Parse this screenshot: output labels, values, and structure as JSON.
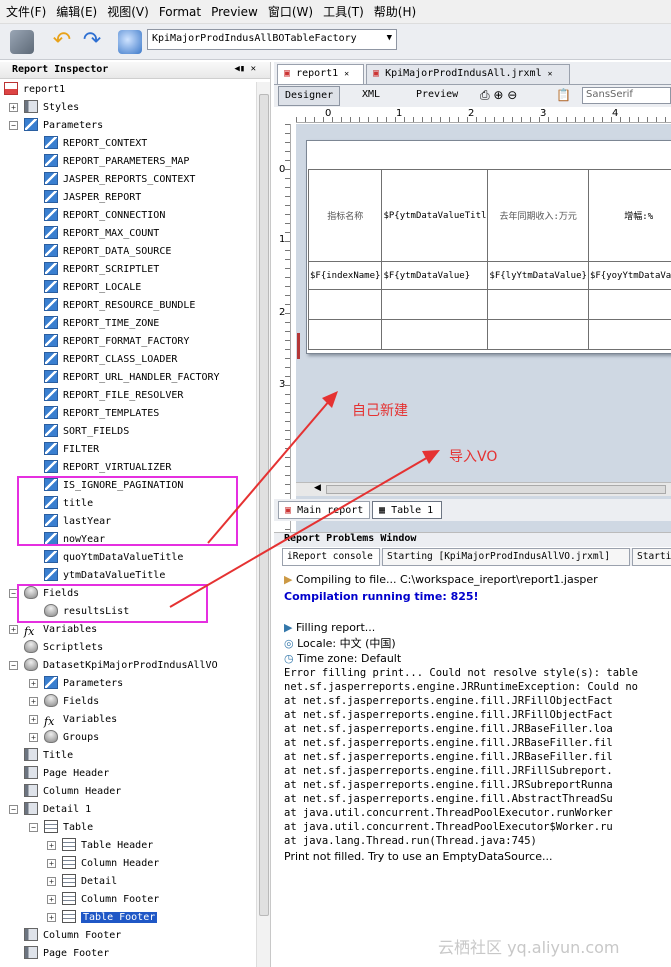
{
  "menu": [
    "文件(F)",
    "编辑(E)",
    "视图(V)",
    "Format",
    "Preview",
    "窗口(W)",
    "工具(T)",
    "帮助(H)"
  ],
  "toolbar": {
    "combo_value": "KpiMajorProdIndusAllBOTableFactory"
  },
  "inspector": {
    "title": "Report Inspector",
    "root": "report1",
    "items": {
      "styles": "Styles",
      "parameters": "Parameters",
      "params": [
        "REPORT_CONTEXT",
        "REPORT_PARAMETERS_MAP",
        "JASPER_REPORTS_CONTEXT",
        "JASPER_REPORT",
        "REPORT_CONNECTION",
        "REPORT_MAX_COUNT",
        "REPORT_DATA_SOURCE",
        "REPORT_SCRIPTLET",
        "REPORT_LOCALE",
        "REPORT_RESOURCE_BUNDLE",
        "REPORT_TIME_ZONE",
        "REPORT_FORMAT_FACTORY",
        "REPORT_CLASS_LOADER",
        "REPORT_URL_HANDLER_FACTORY",
        "REPORT_FILE_RESOLVER",
        "REPORT_TEMPLATES",
        "SORT_FIELDS",
        "FILTER",
        "REPORT_VIRTUALIZER",
        "IS_IGNORE_PAGINATION",
        "title",
        "lastYear",
        "nowYear",
        "quoYtmDataValueTitle",
        "ytmDataValueTitle"
      ],
      "fields": "Fields",
      "field_results": "resultsList",
      "variables": "Variables",
      "scriptlets": "Scriptlets",
      "dataset": "DatasetKpiMajorProdIndusAllVO",
      "ds_parameters": "Parameters",
      "ds_fields": "Fields",
      "ds_variables": "Variables",
      "ds_groups": "Groups",
      "title_band": "Title",
      "page_header": "Page Header",
      "column_header": "Column Header",
      "detail1": "Detail 1",
      "table": "Table",
      "table_header": "Table Header",
      "t_column_header": "Column Header",
      "t_detail": "Detail",
      "t_column_footer": "Column Footer",
      "table_footer": "Table Footer",
      "column_footer": "Column Footer",
      "page_footer": "Page Footer"
    }
  },
  "editor": {
    "tabs": [
      "report1",
      "KpiMajorProdIndusAll.jrxml"
    ],
    "modes": [
      "Designer",
      "XML",
      "Preview"
    ],
    "font_combo": "SansSerif",
    "ruler_h": [
      "0",
      "1",
      "2",
      "3",
      "4"
    ],
    "ruler_v": [
      "0",
      "1",
      "2",
      "3"
    ],
    "table_headers": [
      "指标名称",
      "$P{ytmDataValueTitl",
      "去年同期收入:万元",
      "增幅:%"
    ],
    "table_cells": [
      "$F{indexName}",
      "$F{ytmDataValue}",
      "$F{lyYtmDataValue}",
      "$F{yoyYtmDataValue"
    ],
    "bottom_tabs": [
      "Main report",
      "Table 1"
    ]
  },
  "problems": {
    "title": "Report Problems Window",
    "tabs": [
      "iReport console",
      "Starting [KpiMajorProdIndusAllVO.jrxml]",
      "Startin"
    ],
    "log": [
      {
        "t": "Compiling to file... C:\\workspace_ireport\\report1.jasper",
        "style": "sans"
      },
      {
        "t": "Compilation running time: 825!",
        "style": "blue"
      },
      {
        "t": "Filling report...",
        "style": "sans"
      },
      {
        "t": "Locale: 中文 (中国)",
        "style": "sans"
      },
      {
        "t": "Time zone: Default",
        "style": "sans"
      },
      {
        "t": "Error filling print... Could not resolve style(s): table",
        "style": "mono"
      },
      {
        "t": "net.sf.jasperreports.engine.JRRuntimeException: Could no",
        "style": "mono"
      },
      {
        "t": "    at net.sf.jasperreports.engine.fill.JRFillObjectFact",
        "style": "mono"
      },
      {
        "t": "    at net.sf.jasperreports.engine.fill.JRFillObjectFact",
        "style": "mono"
      },
      {
        "t": "    at net.sf.jasperreports.engine.fill.JRBaseFiller.loa",
        "style": "mono"
      },
      {
        "t": "    at net.sf.jasperreports.engine.fill.JRBaseFiller.fil",
        "style": "mono"
      },
      {
        "t": "    at net.sf.jasperreports.engine.fill.JRBaseFiller.fil",
        "style": "mono"
      },
      {
        "t": "    at net.sf.jasperreports.engine.fill.JRFillSubreport.",
        "style": "mono"
      },
      {
        "t": "    at net.sf.jasperreports.engine.fill.JRSubreportRunna",
        "style": "mono"
      },
      {
        "t": "    at net.sf.jasperreports.engine.fill.AbstractThreadSu",
        "style": "mono"
      },
      {
        "t": "    at java.util.concurrent.ThreadPoolExecutor.runWorker",
        "style": "mono"
      },
      {
        "t": "    at java.util.concurrent.ThreadPoolExecutor$Worker.ru",
        "style": "mono"
      },
      {
        "t": "    at java.lang.Thread.run(Thread.java:745)",
        "style": "mono"
      },
      {
        "t": "Print not filled. Try to use an EmptyDataSource...",
        "style": "sans"
      }
    ]
  },
  "annotations": {
    "self_built": "自己新建",
    "import_vo": "导入VO"
  },
  "watermark": "云栖社区 yq.aliyun.com",
  "colors": {
    "highlight": "#e52fe0",
    "arrow": "#e53232",
    "selection": "#1f57c6",
    "compile_blue": "#0000cc"
  }
}
